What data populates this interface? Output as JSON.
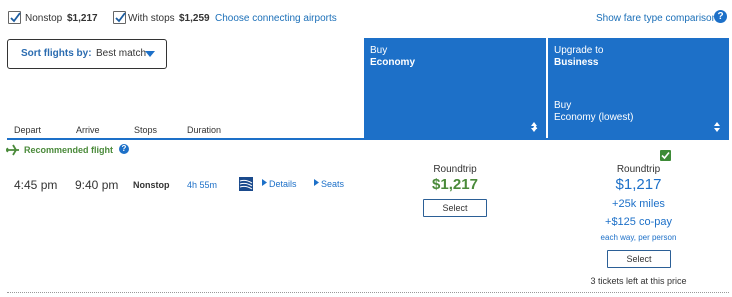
{
  "filters": {
    "nonstop_label": "Nonstop",
    "nonstop_price": "$1,217",
    "withstops_label": "With stops",
    "withstops_price": "$1,259",
    "connecting_link": "Choose connecting airports",
    "fare_compare_link": "Show fare type comparison"
  },
  "sort": {
    "label": "Sort flights by:",
    "value": "Best match"
  },
  "columns": {
    "economy": {
      "line1": "Buy",
      "line2": "Economy"
    },
    "business": {
      "line1": "Upgrade to",
      "line2": "Business",
      "line3": "Buy",
      "line4": "Economy (lowest)"
    }
  },
  "table_headers": {
    "depart": "Depart",
    "arrive": "Arrive",
    "stops": "Stops",
    "duration": "Duration"
  },
  "recommended_label": "Recommended flight",
  "flight": {
    "depart": "4:45 pm",
    "arrive": "9:40 pm",
    "stops": "Nonstop",
    "duration": "4h 55m",
    "details_link": "Details",
    "seats_link": "Seats"
  },
  "economy_offer": {
    "type": "Roundtrip",
    "price": "$1,217",
    "select_label": "Select"
  },
  "business_offer": {
    "type": "Roundtrip",
    "price": "$1,217",
    "miles": "+25k miles",
    "copay": "+$125 co-pay",
    "copay_note": "each way, per person",
    "select_label": "Select",
    "tickets_left": "3 tickets left at this price"
  },
  "colors": {
    "accent": "#1d70c8",
    "green": "#4a8a3a",
    "check_green": "#3d8b37"
  }
}
